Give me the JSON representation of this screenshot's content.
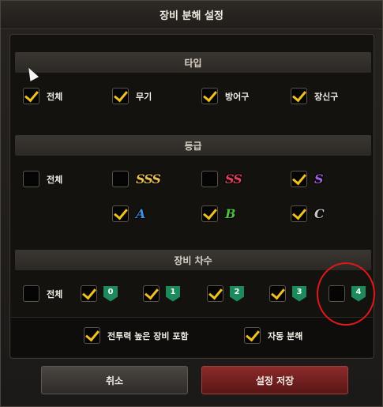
{
  "dialog": {
    "title": "장비 분해 설정"
  },
  "type_section": {
    "header": "타입",
    "items": [
      {
        "label": "전체",
        "checked": true
      },
      {
        "label": "무기",
        "checked": true
      },
      {
        "label": "방어구",
        "checked": true
      },
      {
        "label": "장신구",
        "checked": true
      }
    ]
  },
  "grade_section": {
    "header": "등급",
    "all": {
      "label": "전체",
      "checked": false
    },
    "grades": [
      {
        "label": "SSS",
        "checked": false
      },
      {
        "label": "SS",
        "checked": true
      },
      {
        "label": "S",
        "checked": true
      },
      {
        "label": "A",
        "checked": true
      },
      {
        "label": "B",
        "checked": true
      },
      {
        "label": "C",
        "checked": true
      }
    ]
  },
  "tier_section": {
    "header": "장비 차수",
    "all": {
      "label": "전체",
      "checked": false
    },
    "tiers": [
      {
        "label": "0",
        "checked": true
      },
      {
        "label": "1",
        "checked": true
      },
      {
        "label": "2",
        "checked": true
      },
      {
        "label": "3",
        "checked": true
      },
      {
        "label": "4",
        "checked": false
      }
    ]
  },
  "options": {
    "include_high_power": {
      "label": "전투력 높은 장비 포함",
      "checked": true
    },
    "auto_disassemble": {
      "label": "자동 분해",
      "checked": true
    }
  },
  "buttons": {
    "cancel": "취소",
    "save": "설정 저장"
  },
  "colors": {
    "check_mark": "#f0c020",
    "save_button": "#8c2a2a",
    "tier_badge": "#1c8a5a",
    "highlight": "#e01818"
  }
}
